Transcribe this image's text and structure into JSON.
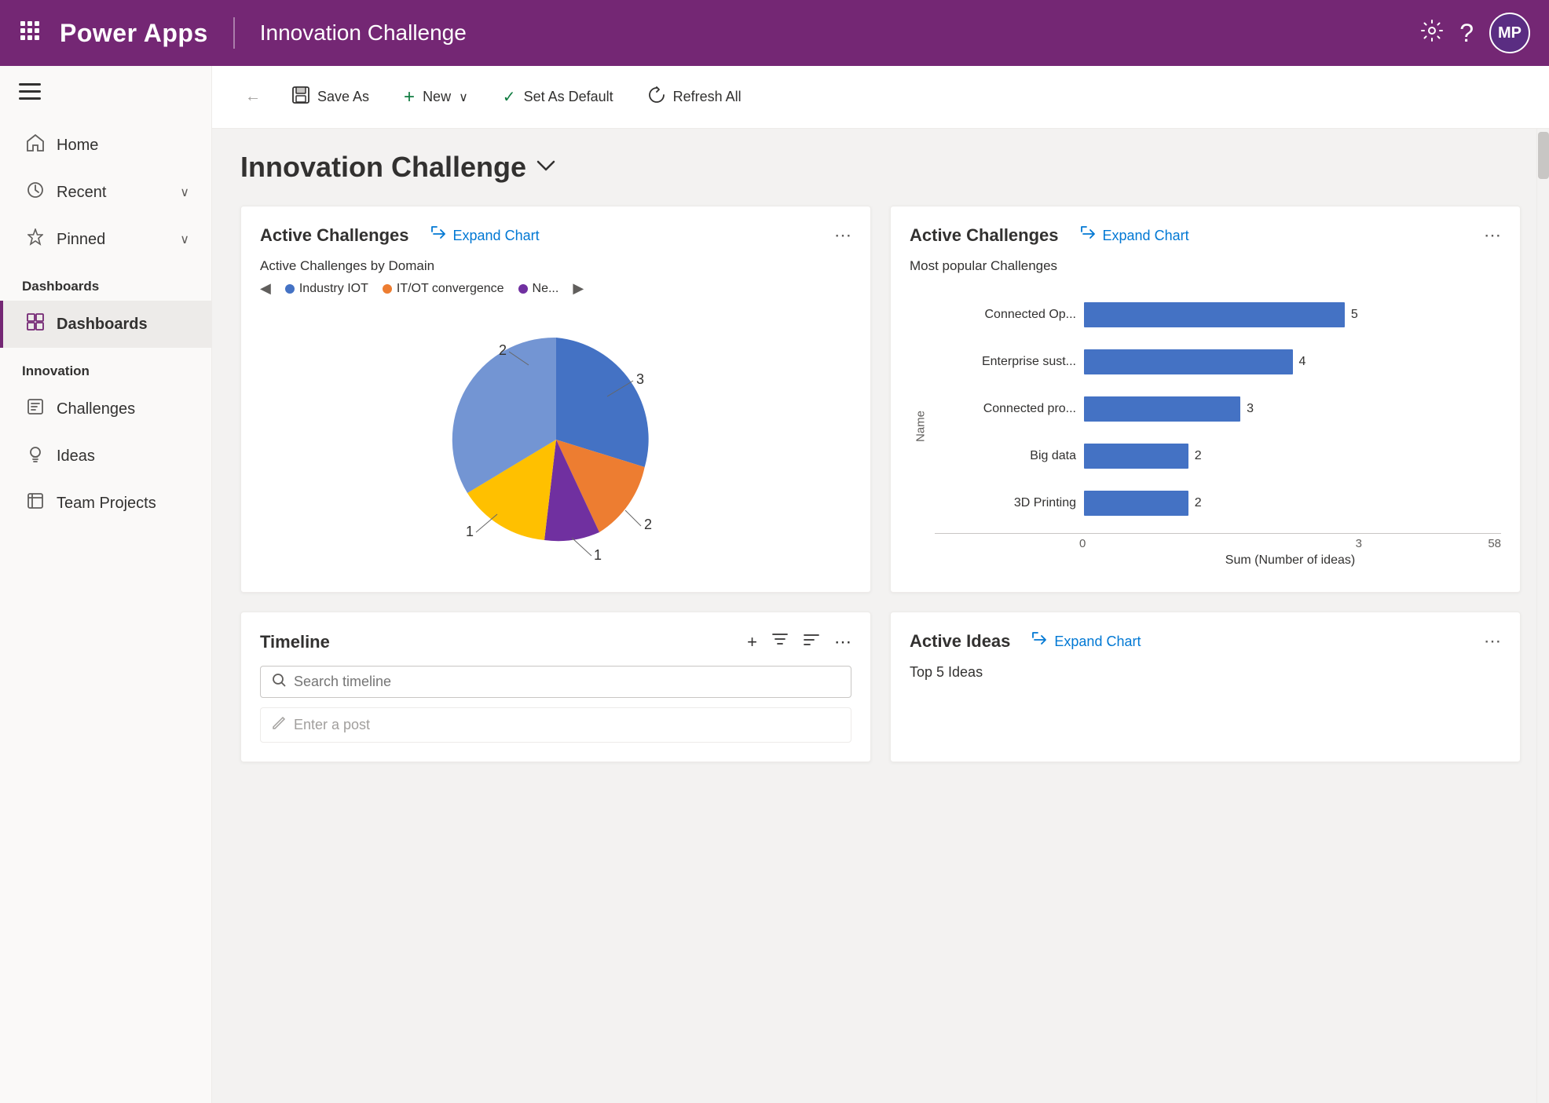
{
  "topnav": {
    "waffle": "⠿",
    "logo": "Power Apps",
    "divider": true,
    "title": "Innovation Challenge",
    "settings_label": "Settings",
    "help_label": "Help",
    "avatar_initials": "MP"
  },
  "toolbar": {
    "back_label": "Back",
    "save_as_label": "Save As",
    "new_label": "New",
    "set_as_default_label": "Set As Default",
    "refresh_all_label": "Refresh All"
  },
  "page": {
    "title": "Innovation Challenge",
    "title_chevron": "⌄"
  },
  "sidebar": {
    "hamburger": "☰",
    "items": [
      {
        "id": "home",
        "icon": "⌂",
        "label": "Home"
      },
      {
        "id": "recent",
        "icon": "◷",
        "label": "Recent",
        "has_chevron": true
      },
      {
        "id": "pinned",
        "icon": "📌",
        "label": "Pinned",
        "has_chevron": true
      }
    ],
    "sections": [
      {
        "label": "Dashboards",
        "items": [
          {
            "id": "dashboards",
            "icon": "📊",
            "label": "Dashboards",
            "active": true
          }
        ]
      },
      {
        "label": "Innovation",
        "items": [
          {
            "id": "challenges",
            "icon": "🎯",
            "label": "Challenges"
          },
          {
            "id": "ideas",
            "icon": "💡",
            "label": "Ideas"
          },
          {
            "id": "team-projects",
            "icon": "📋",
            "label": "Team Projects"
          }
        ]
      }
    ]
  },
  "cards": {
    "active_challenges_pie": {
      "title": "Active Challenges",
      "expand_label": "Expand Chart",
      "subtitle": "Active Challenges by Domain",
      "legend": [
        {
          "label": "Industry IOT",
          "color": "#4472c4"
        },
        {
          "label": "IT/OT convergence",
          "color": "#ed7d31"
        },
        {
          "label": "Ne...",
          "color": "#7030a0"
        }
      ],
      "pie_segments": [
        {
          "label": "3",
          "color": "#4472c4",
          "value": 3
        },
        {
          "label": "2",
          "color": "#4472c4",
          "value": 2
        },
        {
          "label": "2",
          "color": "#ffc000",
          "value": 2
        },
        {
          "label": "1",
          "color": "#ed7d31",
          "value": 1
        },
        {
          "label": "1",
          "color": "#7030a0",
          "value": 1
        }
      ]
    },
    "active_challenges_bar": {
      "title": "Active Challenges",
      "expand_label": "Expand Chart",
      "subtitle": "Most popular Challenges",
      "y_axis_label": "Name",
      "x_axis_label": "Sum (Number of ideas)",
      "bars": [
        {
          "label": "Connected Op...",
          "value": 5
        },
        {
          "label": "Enterprise sust...",
          "value": 4
        },
        {
          "label": "Connected pro...",
          "value": 3
        },
        {
          "label": "Big data",
          "value": 2
        },
        {
          "label": "3D Printing",
          "value": 2
        }
      ],
      "x_ticks": [
        "0",
        "3",
        "5",
        "8"
      ],
      "max_value": 8
    },
    "timeline": {
      "title": "Timeline",
      "search_placeholder": "Search timeline",
      "enter_placeholder": "Enter a post"
    },
    "active_ideas": {
      "title": "Active Ideas",
      "expand_label": "Expand Chart",
      "subtitle": "Top 5 Ideas"
    }
  }
}
